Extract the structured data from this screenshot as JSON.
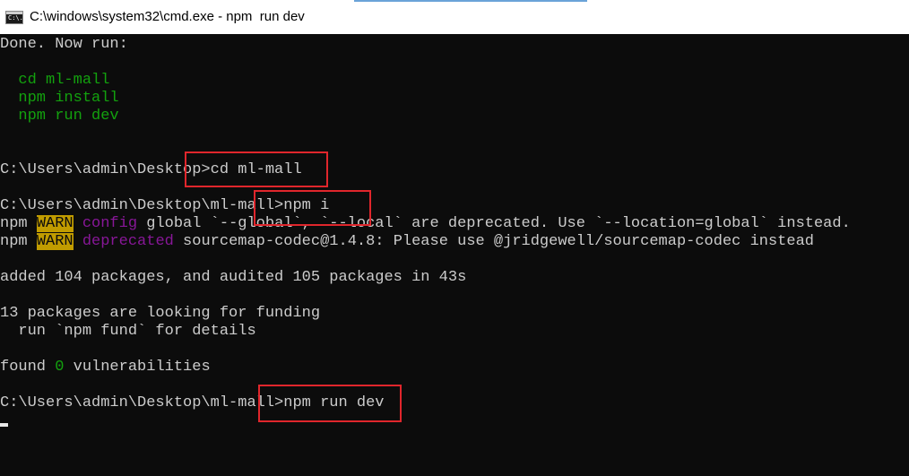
{
  "window": {
    "title": "C:\\windows\\system32\\cmd.exe - npm  run dev",
    "icon_label": "C:\\."
  },
  "console": {
    "done": "Done. Now run:",
    "step1": "  cd ml-mall",
    "step2": "  npm install",
    "step3": "  npm run dev",
    "prompt1": "C:\\Users\\admin\\Desktop>",
    "cmd1": "cd ml-mall",
    "prompt2": "C:\\Users\\admin\\Desktop\\ml-mall>",
    "cmd2": "npm i",
    "npm_label": "npm ",
    "warn_label": "WARN",
    "warn1_tag": "config",
    "warn1_text": " global `--global`, `--local` are deprecated. Use `--location=global` instead.",
    "warn2_tag": "deprecated",
    "warn2_text": " sourcemap-codec@1.4.8: Please use @jridgewell/sourcemap-codec instead",
    "added": "added 104 packages, and audited 105 packages in 43s",
    "funding1": "13 packages are looking for funding",
    "funding2": "  run `npm fund` for details",
    "found_pre": "found ",
    "found_count": "0",
    "found_post": " vulnerabilities",
    "prompt3": "C:\\Users\\admin\\Desktop\\ml-mall>",
    "cmd3": "npm run dev"
  },
  "colors": {
    "background": "#0c0c0c",
    "text": "#cccccc",
    "green": "#13a10e",
    "magenta": "#881798",
    "warn_bg": "#c19c00",
    "highlight": "#e0262c"
  }
}
